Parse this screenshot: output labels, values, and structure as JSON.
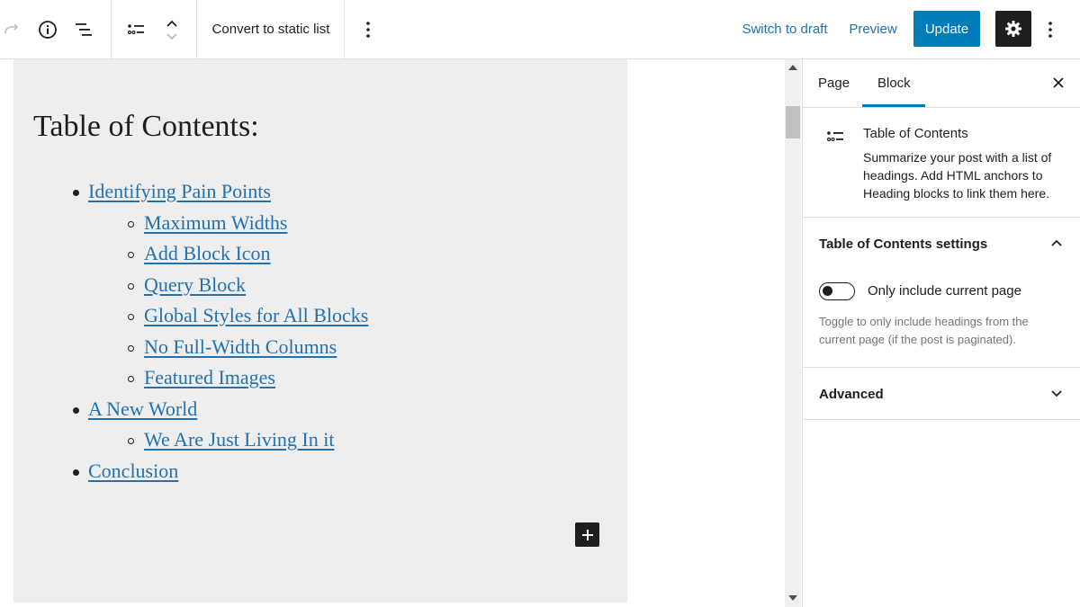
{
  "toolbar": {
    "convert_label": "Convert to static list",
    "switch_draft_label": "Switch to draft",
    "preview_label": "Preview",
    "update_label": "Update"
  },
  "editor": {
    "title": "Table of Contents:",
    "items": [
      {
        "text": "Identifying Pain Points",
        "level": 1
      },
      {
        "text": "Maximum Widths",
        "level": 2
      },
      {
        "text": "Add Block Icon",
        "level": 2
      },
      {
        "text": "Query Block",
        "level": 2
      },
      {
        "text": "Global Styles for All Blocks",
        "level": 2
      },
      {
        "text": "No Full-Width Columns",
        "level": 2
      },
      {
        "text": "Featured Images",
        "level": 2
      },
      {
        "text": "A New World",
        "level": 1
      },
      {
        "text": "We Are Just Living In it",
        "level": 2
      },
      {
        "text": "Conclusion",
        "level": 1
      }
    ]
  },
  "sidebar": {
    "tabs": [
      {
        "label": "Page"
      },
      {
        "label": "Block"
      }
    ],
    "active_tab": "Block",
    "block_card": {
      "title": "Table of Contents",
      "description": "Summarize your post with a list of headings. Add HTML anchors to Heading blocks to link them here."
    },
    "settings_panel": {
      "title": "Table of Contents settings",
      "toggle_label": "Only include current page",
      "toggle_on": false,
      "help": "Toggle to only include headings from the current page (if the post is paginated)."
    },
    "advanced_panel": {
      "title": "Advanced"
    }
  },
  "colors": {
    "accent": "#007cba",
    "link": "#2271b1",
    "canvas_block": "#eeeeee",
    "dark": "#1e1e1e"
  },
  "icons": {
    "redo": "redo-icon",
    "info": "info-icon",
    "list_view": "list-view-icon",
    "toc_block": "table-of-contents-icon",
    "move_up": "chevron-up-icon",
    "move_down": "chevron-down-icon",
    "options": "more-vertical-icon",
    "settings": "gear-icon",
    "close": "close-icon",
    "add_block": "plus-icon"
  }
}
